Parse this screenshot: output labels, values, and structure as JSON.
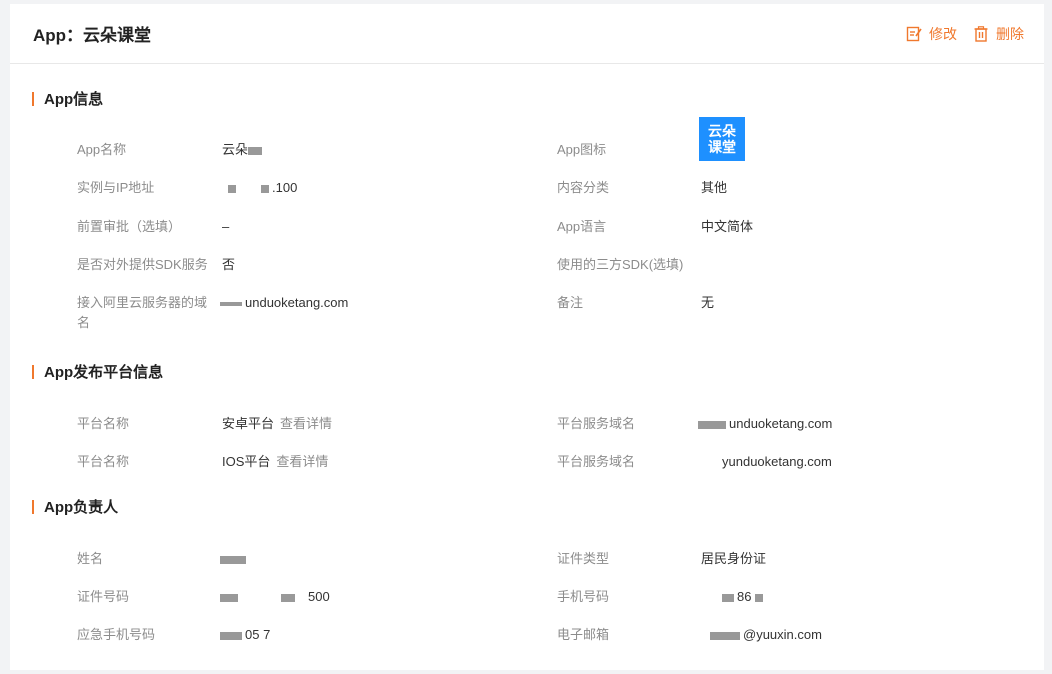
{
  "header": {
    "title": "App：云朵课堂",
    "edit_label": "修改",
    "delete_label": "删除"
  },
  "sections": {
    "app_info": {
      "title": "App信息",
      "rows": [
        {
          "label1": "App名称",
          "value1": "云朵",
          "label2": "App图标",
          "value2": ""
        },
        {
          "label1": "实例与IP地址",
          "value1": ".100",
          "label2": "内容分类",
          "value2": "其他"
        },
        {
          "label1": "前置审批（选填）",
          "value1": "–",
          "label2": "App语言",
          "value2": "中文简体"
        },
        {
          "label1": "是否对外提供SDK服务",
          "value1": "否",
          "label2": "使用的三方SDK(选填)",
          "value2": ""
        },
        {
          "label1": "接入阿里云服务器的域名",
          "value1": "unduoketang.com",
          "label2": "备注",
          "value2": "无"
        }
      ],
      "icon_text_line1": "云朵",
      "icon_text_line2": "课堂"
    },
    "platform": {
      "title": "App发布平台信息",
      "rows": [
        {
          "label1": "平台名称",
          "value1": "安卓平台",
          "link": "查看详情",
          "label2": "平台服务域名",
          "value2": "unduoketang.com"
        },
        {
          "label1": "平台名称",
          "value1": "IOS平台",
          "link": "查看详情",
          "label2": "平台服务域名",
          "value2": "yunduoketang.com"
        }
      ]
    },
    "owner": {
      "title": "App负责人",
      "rows": [
        {
          "label1": "姓名",
          "value1": "",
          "label2": "证件类型",
          "value2": "居民身份证"
        },
        {
          "label1": "证件号码",
          "value1": "500",
          "label2": "手机号码",
          "value2": "86"
        },
        {
          "label1": "应急手机号码",
          "value1": "05  7",
          "label2": "电子邮箱",
          "value2": "@yuuxin.com"
        }
      ]
    }
  },
  "colors": {
    "accent": "#f0782d",
    "icon_bg": "#1e90ff"
  }
}
